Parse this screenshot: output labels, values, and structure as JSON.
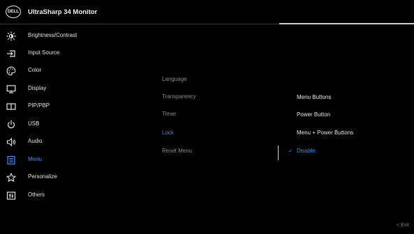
{
  "header": {
    "logo_text": "DELL",
    "title": "UltraSharp 34 Monitor"
  },
  "menu": {
    "items": [
      {
        "label": "Brightness/Contrast",
        "icon": "brightness-icon"
      },
      {
        "label": "Input Source",
        "icon": "input-source-icon"
      },
      {
        "label": "Color",
        "icon": "color-icon"
      },
      {
        "label": "Display",
        "icon": "display-icon"
      },
      {
        "label": "PIP/PBP",
        "icon": "pip-pbp-icon"
      },
      {
        "label": "USB",
        "icon": "usb-icon"
      },
      {
        "label": "Audio",
        "icon": "audio-icon"
      },
      {
        "label": "Menu",
        "icon": "menu-icon",
        "active": true
      },
      {
        "label": "Personalize",
        "icon": "star-icon"
      },
      {
        "label": "Others",
        "icon": "others-icon"
      }
    ]
  },
  "submenu": {
    "items": [
      {
        "label": "Language"
      },
      {
        "label": "Transparency"
      },
      {
        "label": "Timer"
      },
      {
        "label": "Lock",
        "selected": true
      },
      {
        "label": "Reset Menu"
      }
    ]
  },
  "options": {
    "items": [
      {
        "label": "Menu Buttons"
      },
      {
        "label": "Power Button"
      },
      {
        "label": "Menu + Power Buttons"
      },
      {
        "label": "Disable",
        "selected": true
      }
    ],
    "check_mark": "✓"
  },
  "footer": {
    "exit_label": "Exit",
    "exit_arrow": "<"
  },
  "colors": {
    "background": "#000000",
    "accent_blue": "#3c8ef0",
    "text": "#e6e6e6",
    "muted_text": "#8a8a8a"
  }
}
